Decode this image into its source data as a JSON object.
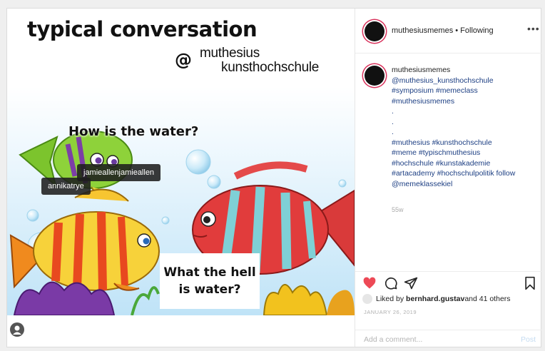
{
  "image": {
    "title": "typical conversation",
    "brand_at": "@",
    "brand_line1": "muthesius",
    "brand_line2": "kunsthochschule",
    "question": "How is the water?",
    "answer_line1": "What the hell",
    "answer_line2": "is water?",
    "tags": [
      "jamieallenjamieallen",
      "annikatrye"
    ]
  },
  "header": {
    "username": "muthesiusmemes",
    "separator": " • ",
    "follow_status": "Following",
    "more": "•••"
  },
  "caption": {
    "username": "muthesiusmemes",
    "lines": [
      "@muthesius_kunsthochschule",
      "#symposium #memeclass",
      "#muthesiusmemes",
      ".",
      ".",
      ".",
      "#muthesius #kunsthochschule",
      "#meme #typischmuthesius",
      "#hochschule #kunstakademie",
      "#artacademy #hochschulpolitik follow",
      "@memeklassekiel"
    ],
    "time": "55w"
  },
  "likes": {
    "prefix": "Liked by ",
    "user": "bernhard.gustav",
    "suffix": " and 41 others"
  },
  "date": "JANUARY 26, 2019",
  "comment": {
    "placeholder": "Add a comment...",
    "post": "Post"
  },
  "colors": {
    "like": "#ed4956",
    "link": "#1d3f83",
    "story_ring": "#d8315b"
  }
}
